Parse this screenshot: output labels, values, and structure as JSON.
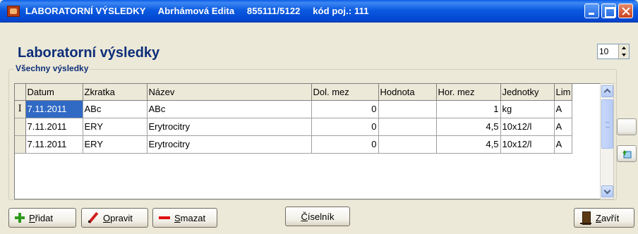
{
  "window": {
    "title_parts": [
      "LABORATORNÍ VÝSLEDKY",
      "Abrhámová Edita",
      "855111/5122",
      "kód poj.: 111"
    ]
  },
  "page": {
    "title": "Laboratorní výsledky",
    "page_size_value": "10"
  },
  "group": {
    "label": "Všechny výsledky"
  },
  "table": {
    "columns": [
      "Datum",
      "Zkratka",
      "Název",
      "Dol. mez",
      "Hodnota",
      "Hor. mez",
      "Jednotky",
      "Lim"
    ],
    "current_row_marker": "I",
    "rows": [
      [
        "7.11.2011",
        "ABc",
        "ABc",
        "0",
        "",
        "1",
        "kg",
        "A"
      ],
      [
        "7.11.2011",
        "ERY",
        "Erytrocitry",
        "0",
        "",
        "4,5",
        "10x12/l",
        "A"
      ],
      [
        "7.11.2011",
        "ERY",
        "Erytrocitry",
        "0",
        "",
        "4,5",
        "10x12/l",
        "A"
      ]
    ],
    "selected_row": 0,
    "selected_column": 0
  },
  "buttons": {
    "add": {
      "pre": "",
      "accel": "P",
      "post": "řidat",
      "icon": "plus-icon"
    },
    "edit": {
      "pre": "",
      "accel": "O",
      "post": "pravit",
      "icon": "pencil-icon"
    },
    "delete": {
      "pre": "",
      "accel": "S",
      "post": "mazat",
      "icon": "minus-icon"
    },
    "codelist": {
      "pre": "",
      "accel": "Č",
      "post": "íselník"
    },
    "close": {
      "pre": "",
      "accel": "Z",
      "post": "avřít",
      "icon": "door-icon"
    }
  },
  "colors": {
    "title_blue": "#0D2E78",
    "selection": "#316AC5",
    "window_bg": "#ECE9D8"
  }
}
